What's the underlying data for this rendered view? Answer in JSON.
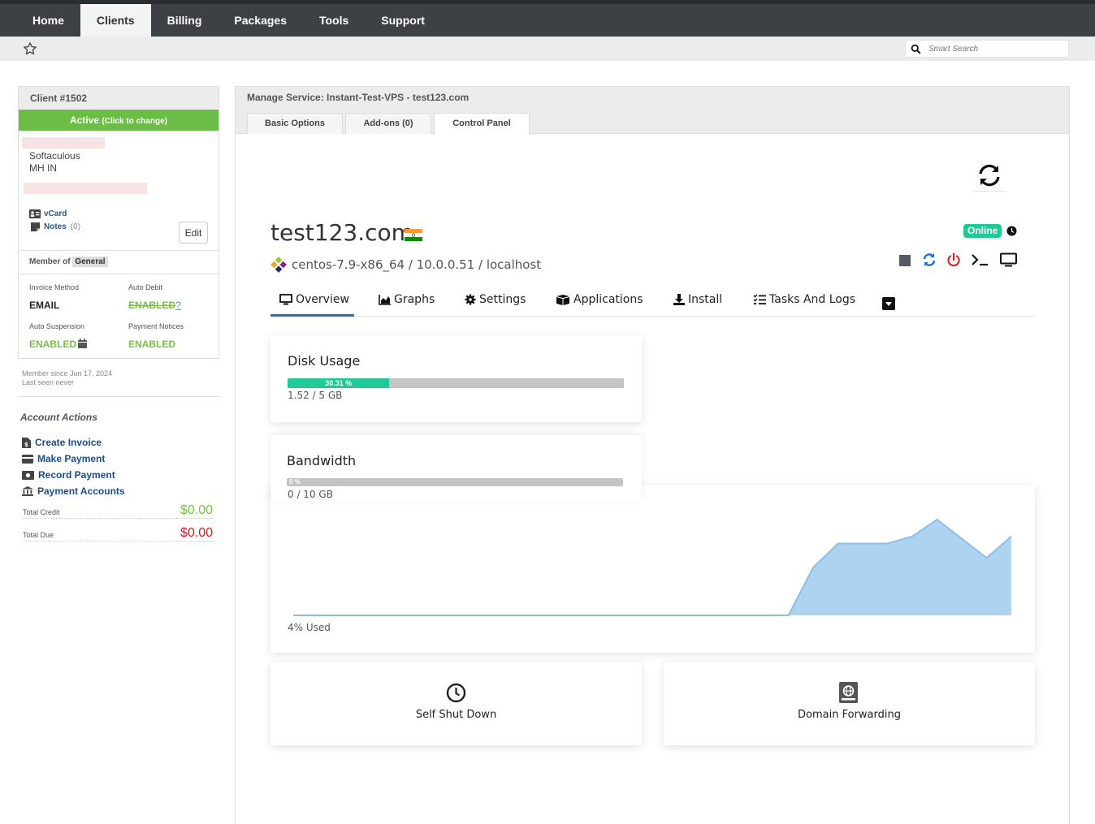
{
  "nav": {
    "items": [
      "Home",
      "Clients",
      "Billing",
      "Packages",
      "Tools",
      "Support"
    ],
    "active": "Clients"
  },
  "search": {
    "placeholder": "Smart Search"
  },
  "client": {
    "title": "Client #1502",
    "status": "Active",
    "status_hint": "(Click to change)",
    "company": "Softaculous",
    "location": "MH IN",
    "vcard": "vCard",
    "notes": "Notes",
    "notes_count": "(0)",
    "edit": "Edit",
    "member_of": "Member of",
    "group": "General",
    "invoice_method_label": "Invoice Method",
    "invoice_method": "EMAIL",
    "auto_debit_label": "Auto Debit",
    "auto_debit": "ENABLED",
    "auto_debit_help": "?",
    "auto_suspension_label": "Auto Suspension",
    "auto_suspension": "ENABLED",
    "payment_notices_label": "Payment Notices",
    "payment_notices": "ENABLED",
    "member_since": "Member since Jun 17, 2024",
    "last_seen": "Last seen never"
  },
  "account_actions": {
    "title": "Account Actions",
    "items": [
      "Create Invoice",
      "Make Payment",
      "Record Payment",
      "Payment Accounts"
    ],
    "total_credit_label": "Total Credit",
    "total_credit": "$0.00",
    "total_due_label": "Total Due",
    "total_due": "$0.00"
  },
  "service": {
    "title": "Manage Service: Instant-Test-VPS - test123.com",
    "tabs": [
      "Basic Options",
      "Add-ons (0)",
      "Control Panel"
    ],
    "active_tab": "Control Panel"
  },
  "vps": {
    "hostname": "test123.com",
    "status": "Online",
    "os_line": "centos-7.9-x86_64 / 10.0.0.51 / localhost",
    "tabs": [
      "Overview",
      "Graphs",
      "Settings",
      "Applications",
      "Install",
      "Tasks And Logs"
    ],
    "active_tab": "Overview",
    "disk": {
      "title": "Disk Usage",
      "percent_label": "30.31 %",
      "percent": 30.31,
      "usage": "1.52 / 5 GB"
    },
    "bandwidth": {
      "title": "Bandwidth",
      "percent_label": "0 %",
      "percent": 0,
      "usage": "0 / 10 GB"
    },
    "cpu_caption": "4% Used",
    "features": [
      "Self Shut Down",
      "Domain Forwarding"
    ]
  },
  "chart_data": {
    "type": "area",
    "x": [
      0,
      1,
      2,
      3,
      4,
      5,
      6,
      7,
      8,
      9,
      10,
      11,
      12,
      13,
      14,
      15,
      16,
      17,
      18,
      19,
      20,
      21,
      22,
      23,
      24,
      25,
      26,
      27,
      28,
      29
    ],
    "values": [
      0,
      0,
      0,
      0,
      0,
      0,
      0,
      0,
      0,
      0,
      0,
      0,
      0,
      0,
      0,
      0,
      0,
      0,
      0,
      0,
      0,
      2,
      3,
      3,
      3,
      3.3,
      4,
      3.2,
      2.4,
      3.3
    ],
    "color": "#aed3f0",
    "line_color": "#8dbfe6"
  },
  "colors": {
    "green": "#6cbd45",
    "teal": "#20c997",
    "link": "#1a4d8c",
    "nav": "#3d4146",
    "red": "#cc2222"
  }
}
